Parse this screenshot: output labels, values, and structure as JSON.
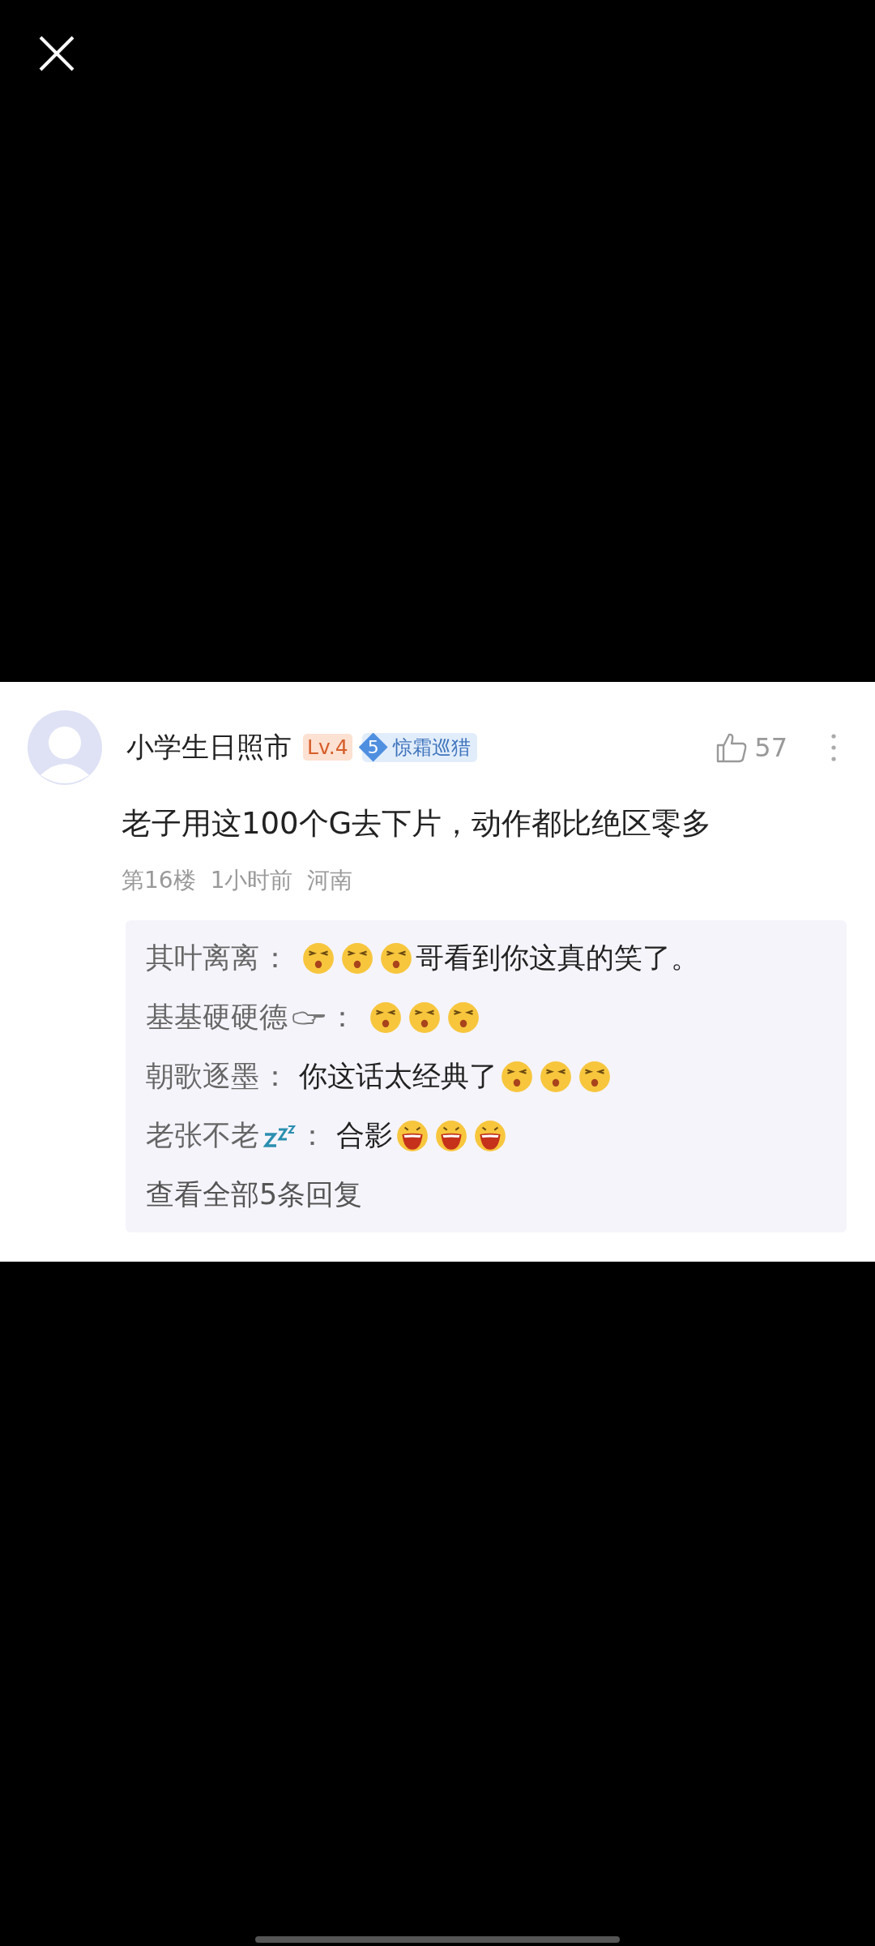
{
  "comment": {
    "author": "小学生日照市",
    "level": "Lv.4",
    "medal": {
      "rank": "5",
      "title": "惊霜巡猎"
    },
    "likes": "57",
    "body": "老子用这100个G去下片，动作都比绝区零多",
    "meta": [
      "第16楼",
      "1小时前",
      "河南"
    ],
    "replies": [
      {
        "author": "其叶离离",
        "separator": "：",
        "parts": [
          {
            "kind": "squint"
          },
          {
            "kind": "squint"
          },
          {
            "kind": "squint"
          },
          {
            "kind": "text",
            "text": "哥看到你这真的笑了。"
          }
        ]
      },
      {
        "author": "基基硬硬德",
        "name_icon": {
          "kind": "hand"
        },
        "separator": "：",
        "parts": [
          {
            "kind": "squint"
          },
          {
            "kind": "squint"
          },
          {
            "kind": "squint"
          }
        ]
      },
      {
        "author": "朝歌逐墨",
        "separator": "：",
        "parts": [
          {
            "kind": "text",
            "text": "你这话太经典了"
          },
          {
            "kind": "squint"
          },
          {
            "kind": "squint"
          },
          {
            "kind": "squint"
          }
        ]
      },
      {
        "author": "老张不老",
        "name_icon": {
          "kind": "sleep"
        },
        "separator": "：",
        "parts": [
          {
            "kind": "text",
            "text": "合影"
          },
          {
            "kind": "laugh"
          },
          {
            "kind": "laugh"
          },
          {
            "kind": "laugh"
          }
        ]
      }
    ],
    "more_replies": "查看全部5条回复"
  }
}
